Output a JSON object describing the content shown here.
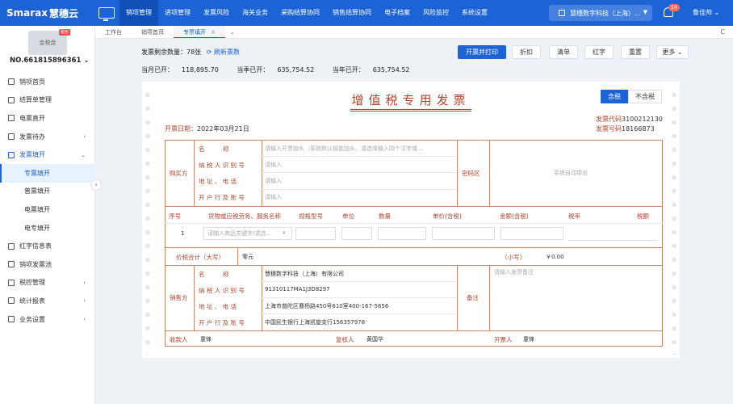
{
  "brand": {
    "logo_en": "Smar",
    "logo_mid": "ax",
    "logo_cn": "慧穗云"
  },
  "nav": [
    "销项管理",
    "进项管理",
    "发票风险",
    "海关业务",
    "采购结算协同",
    "销售结算协同",
    "电子档案",
    "风险监控",
    "系统设置"
  ],
  "header": {
    "company": "慧穗数字科技（上海）...",
    "notif_count": "14",
    "user": "鲁佳帅"
  },
  "sidebar": {
    "card_label": "金税盘",
    "card_tag": "税务",
    "account": "NO.661815896361",
    "items": [
      {
        "label": "销项首页"
      },
      {
        "label": "结算单管理"
      },
      {
        "label": "电票直开"
      },
      {
        "label": "发票待办"
      },
      {
        "label": "发票填开"
      },
      {
        "label": "专票填开"
      },
      {
        "label": "普票填开"
      },
      {
        "label": "电票填开"
      },
      {
        "label": "电专填开"
      },
      {
        "label": "红字信息表"
      },
      {
        "label": "销项发票池"
      },
      {
        "label": "税控管理"
      },
      {
        "label": "统计报表"
      },
      {
        "label": "业务设置"
      }
    ]
  },
  "tabs": [
    {
      "label": "工作台"
    },
    {
      "label": "销项首页"
    },
    {
      "label": "专票填开"
    }
  ],
  "stats": {
    "remaining_label": "发票剩余数量：",
    "remaining_value": "78张",
    "refresh_link": "刷新票数",
    "month_label": "当月已开：",
    "month_value": "118,895.70",
    "quarter_label": "当季已开：",
    "quarter_value": "635,754.52",
    "year_label": "当年已开：",
    "year_value": "635,754.52"
  },
  "toolbar": {
    "issue_print": "开票并打印",
    "discount": "折扣",
    "list": "清单",
    "red": "红字",
    "reset": "重置",
    "more": "更多"
  },
  "invoice": {
    "title": "增值税专用发票",
    "tax_incl": "含税",
    "tax_excl": "不含税",
    "code_label": "发票代码",
    "code_value": "3100212130",
    "number_label": "发票号码",
    "number_value": "18166873",
    "date_label": "开票日期：",
    "date_value": "2022年03月21日",
    "buyer_label": "购买方",
    "field_name": "名　　　称",
    "field_taxid": "纳 税 人 识 别 号",
    "field_addr": "地 址 、 电 话",
    "field_bank": "开 户 行 及 账 号",
    "buyer_name_ph": "请输入开票抬头（系统默认智能加头，请选择输入四个汉字或...",
    "buyer_taxid_ph": "请输入",
    "buyer_addr_ph": "请输入",
    "buyer_bank_ph": "请输入",
    "cipher_label": "密码区",
    "cipher_text": "系统自动带出",
    "col_no": "序号",
    "col_item": "货物或应税劳务、服务名称",
    "col_spec": "规格型号",
    "col_unit": "单位",
    "col_qty": "数量",
    "col_price": "单价(含税)",
    "col_amount": "金额(含税)",
    "col_rate": "税率",
    "col_tax": "税额",
    "row_no": "1",
    "item_ph": "请输入商品关键字/请选...",
    "total_label": "价税合计（大写）",
    "total_cn": "零元",
    "small_label": "（小写）",
    "small_value": "￥0.00",
    "seller_label": "销售方",
    "seller_name": "慧穗数字科技（上海）有限公司",
    "seller_taxid": "91310117MA1J3D8297",
    "seller_addr": "上海市普陀区曹杨路450号610室400-167-5656",
    "seller_bank": "中国民生银行上海凯旋支行156357978",
    "remark_label": "备注",
    "remark_ph": "请输入发票备注",
    "payee_label": "收款人",
    "payee": "童锋",
    "reviewer_label": "复核人",
    "reviewer": "黄国华",
    "issuer_label": "开票人",
    "issuer": "童锋"
  }
}
